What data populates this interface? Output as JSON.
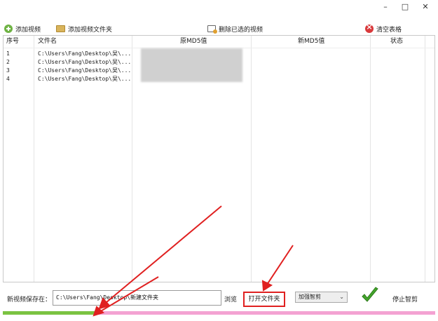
{
  "window": {
    "minimize_glyph": "–",
    "maximize_glyph": "□",
    "close_glyph": "✕"
  },
  "toolbar": {
    "add_video": "添加视频",
    "add_folder": "添加视频文件夹",
    "delete_selected": "删除已选的视频",
    "clear_table": "清空表格"
  },
  "table": {
    "columns": [
      "序号",
      "文件名",
      "原MD5值",
      "新MD5值",
      "状态"
    ],
    "rows": [
      {
        "index": "1",
        "file": "C:\\Users\\Fang\\Desktop\\吴\\..."
      },
      {
        "index": "2",
        "file": "C:\\Users\\Fang\\Desktop\\吴\\..."
      },
      {
        "index": "3",
        "file": "C:\\Users\\Fang\\Desktop\\吴\\..."
      },
      {
        "index": "4",
        "file": "C:\\Users\\Fang\\Desktop\\吴\\..."
      }
    ]
  },
  "bottom": {
    "save_label": "新视频保存在：",
    "save_path": "C:\\Users\\Fang\\Desktop\\新建文件夹",
    "browse": "浏览",
    "open_folder": "打开文件夹",
    "speed_mode": "加强智剪",
    "stop": "停止智剪"
  },
  "progress": {
    "fraction": 0.22
  },
  "colors": {
    "progress_done": "#7bc342",
    "progress_rest": "#f3a2d2",
    "annotation": "#e02020",
    "check": "#43a52c"
  },
  "icons": [
    "add-icon",
    "folder-icon",
    "delete-icon",
    "clear-icon",
    "checkmark-icon"
  ]
}
